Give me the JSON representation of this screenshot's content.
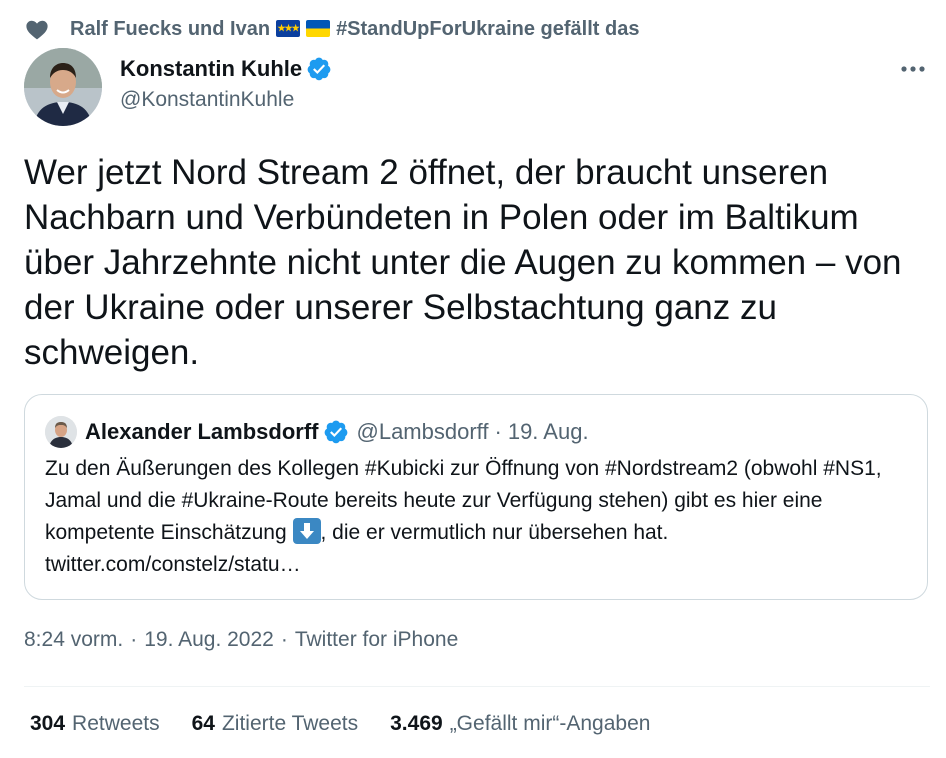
{
  "social_context": {
    "prefix": "Ralf Fuecks und Ivan",
    "flag_1": "eu-flag",
    "flag_2": "ukraine-flag",
    "suffix": "#StandUpForUkraine gefällt das",
    "icon": "heart-icon"
  },
  "author": {
    "name": "Konstantin Kuhle",
    "handle": "@KonstantinKuhle",
    "verified": true
  },
  "tweet": {
    "text": "Wer jetzt Nord Stream 2 öffnet, der braucht unseren Nachbarn und Verbündeten in Polen oder im Baltikum über Jahrzehnte nicht unter die Augen zu kommen – von der Ukraine oder unserer Selbstachtung ganz zu schweigen."
  },
  "quote": {
    "name": "Alexander Lambsdorff",
    "handle": "@Lambsdorff",
    "separator": "·",
    "date": "19. Aug.",
    "text_before_emoji": "Zu den Äußerungen des Kollegen #Kubicki zur Öffnung von #Nordstream2 (obwohl #NS1, Jamal und die #Ukraine-Route bereits heute zur Verfügung stehen) gibt es hier eine kompetente Einschätzung",
    "emoji": "down-arrow-icon",
    "text_after_emoji": ", die er vermutlich nur übersehen hat. twitter.com/constelz/statu…"
  },
  "meta": {
    "time": "8:24 vorm.",
    "separator": "·",
    "date": "19. Aug. 2022",
    "source": "Twitter for iPhone"
  },
  "stats": {
    "retweets_count": "304",
    "retweets_label": "Retweets",
    "quotes_count": "64",
    "quotes_label": "Zitierte Tweets",
    "likes_count": "3.469",
    "likes_label": "„Gefällt mir“-Angaben"
  },
  "colors": {
    "text_primary": "#0f1419",
    "text_secondary": "#536471",
    "verified_blue": "#1d9bf0",
    "border": "#cfd9de"
  }
}
